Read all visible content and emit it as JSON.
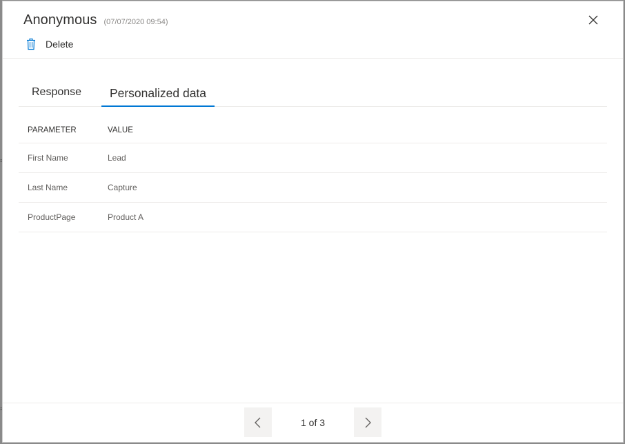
{
  "header": {
    "title": "Anonymous",
    "timestamp": "(07/07/2020 09:54)",
    "delete_label": "Delete"
  },
  "tabs": [
    {
      "label": "Response",
      "selected": false
    },
    {
      "label": "Personalized data",
      "selected": true
    }
  ],
  "table": {
    "columns": [
      "PARAMETER",
      "VALUE"
    ],
    "rows": [
      [
        "First Name",
        "Lead"
      ],
      [
        "Last Name",
        "Capture"
      ],
      [
        "ProductPage",
        "Product A"
      ]
    ]
  },
  "pager": {
    "text": "1 of 3"
  },
  "icons": {
    "close": "close-icon",
    "delete": "trash-icon",
    "prev": "chevron-left-icon",
    "next": "chevron-right-icon"
  },
  "colors": {
    "accent": "#0078d4",
    "text": "#323130",
    "muted": "#8a8886",
    "button_bg": "#f3f2f1"
  }
}
